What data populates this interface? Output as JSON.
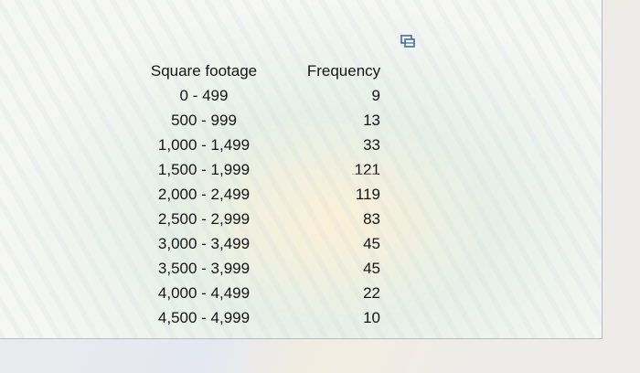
{
  "table": {
    "headers": {
      "square_footage": "Square footage",
      "frequency": "Frequency"
    },
    "rows": [
      {
        "range": "0 - 499",
        "frequency": "9"
      },
      {
        "range": "500 - 999",
        "frequency": "13"
      },
      {
        "range": "1,000 - 1,499",
        "frequency": "33"
      },
      {
        "range": "1,500 - 1,999",
        "frequency": "121"
      },
      {
        "range": "2,000 - 2,499",
        "frequency": "119"
      },
      {
        "range": "2,500 - 2,999",
        "frequency": "83"
      },
      {
        "range": "3,000 - 3,499",
        "frequency": "45"
      },
      {
        "range": "3,500 - 3,999",
        "frequency": "45"
      },
      {
        "range": "4,000 - 4,499",
        "frequency": "22"
      },
      {
        "range": "4,500 - 4,999",
        "frequency": "10"
      }
    ]
  },
  "icons": {
    "copy": "copy-data-icon"
  },
  "colors": {
    "icon": "#4a6a9a",
    "text": "#151515"
  }
}
